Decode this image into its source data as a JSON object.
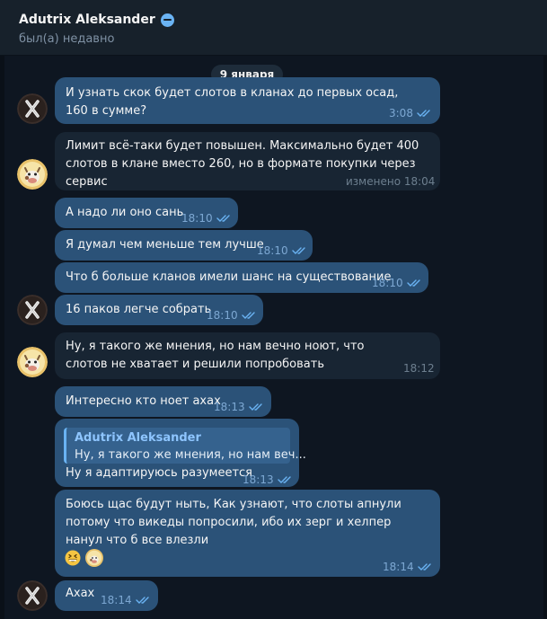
{
  "header": {
    "title": "Adutrix Aleksander",
    "status": "был(а) недавно"
  },
  "date_separator": "9 января",
  "messages": [
    {
      "direction": "out",
      "text": "И узнать скок будет слотов в кланах до первых осад, 160 в сумме?",
      "time": "3:08",
      "read": true
    },
    {
      "direction": "in",
      "text": "Лимит всё-таки будет повышен. Максимально будет 400 слотов в клане вместо 260, но в формате покупки через сервис",
      "time": "изменено 18:04"
    },
    {
      "direction": "out",
      "text": "А надо ли оно сань",
      "time": "18:10",
      "read": true
    },
    {
      "direction": "out",
      "text": "Я думал чем меньше тем лучше",
      "time": "18:10",
      "read": true
    },
    {
      "direction": "out",
      "text": "Что б больше кланов имели шанс на существование",
      "time": "18:10",
      "read": true
    },
    {
      "direction": "out",
      "text": "16 паков легче собрать",
      "time": "18:10",
      "read": true
    },
    {
      "direction": "in",
      "text": "Ну, я такого же мнения, но нам вечно ноют, что слотов не хватает и решили попробовать",
      "time": "18:12"
    },
    {
      "direction": "out",
      "text": "Интересно кто ноет ахах",
      "time": "18:13",
      "read": true
    },
    {
      "direction": "out",
      "text": "Ну я адаптируюсь разумеется",
      "time": "18:13",
      "read": true,
      "reply_to": {
        "author": "Adutrix Aleksander",
        "text": "Ну, я такого же мнения, но нам веч..."
      }
    },
    {
      "direction": "out",
      "text": "Боюсь щас будут ныть, Как узнают, что слоты апнули потому что викеды попросили, ибо их зерг и хелпер нанул что б все влезли",
      "time": "18:14",
      "read": true,
      "reactions": [
        "grin-emoji",
        "cow-avatar"
      ]
    },
    {
      "direction": "out",
      "text": "Ахах",
      "time": "18:14",
      "read": true
    }
  ],
  "colors": {
    "background": "#0e1621",
    "header": "#17212b",
    "bubble_in": "#182533",
    "bubble_out": "#2b5278",
    "accent": "#6ab3f3",
    "meta_out": "#7da8d3"
  },
  "icons": {
    "verified": "verified-badge-icon",
    "read": "double-check-icon",
    "avatar_self": "x-logo-avatar",
    "avatar_peer": "cow-avatar"
  }
}
